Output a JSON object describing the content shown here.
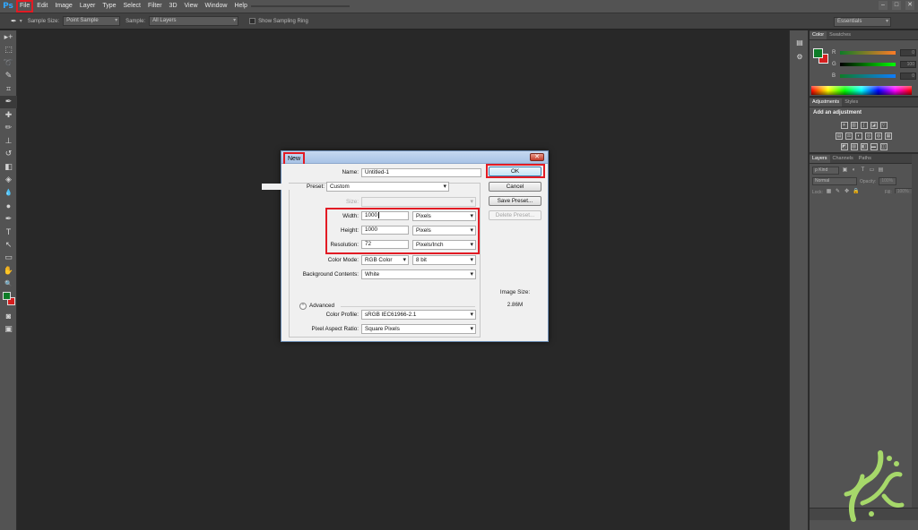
{
  "app": {
    "logo": "Ps"
  },
  "menu": [
    "File",
    "Edit",
    "Image",
    "Layer",
    "Type",
    "Select",
    "Filter",
    "3D",
    "View",
    "Window",
    "Help"
  ],
  "window_controls": [
    "–",
    "□",
    "✕"
  ],
  "options_bar": {
    "sample_size_label": "Sample Size:",
    "sample_size_value": "Point Sample",
    "sample_label": "Sample:",
    "sample_value": "All Layers",
    "show_ring_label": "Show Sampling Ring",
    "workspace": "Essentials"
  },
  "tools": [
    "move-icon",
    "marquee-icon",
    "lasso-icon",
    "quick-select-icon",
    "crop-icon",
    "eyedropper-icon",
    "spot-healing-icon",
    "brush-icon",
    "clone-stamp-icon",
    "history-brush-icon",
    "eraser-icon",
    "paint-bucket-icon",
    "blur-icon",
    "dodge-icon",
    "pen-icon",
    "type-icon",
    "path-select-icon",
    "rectangle-icon",
    "hand-icon",
    "zoom-icon"
  ],
  "tool_glyphs": [
    "▸+",
    "⬚",
    "➰",
    "✎",
    "⌗",
    "✒",
    "✚",
    "✏",
    "⊥",
    "↺",
    "◧",
    "◈",
    "💧",
    "●",
    "✒",
    "T",
    "↖",
    "▭",
    "✋",
    "🔍"
  ],
  "colors": {
    "foreground": "#0e7c27",
    "background": "#d41e1e",
    "highlight": "#e21b24"
  },
  "color_panel": {
    "tabs": [
      "Color",
      "Swatches"
    ],
    "channels": [
      {
        "name": "R",
        "value": "0"
      },
      {
        "name": "G",
        "value": "100"
      },
      {
        "name": "B",
        "value": "0"
      }
    ]
  },
  "adjustments_panel": {
    "tabs": [
      "Adjustments",
      "Styles"
    ],
    "title": "Add an adjustment"
  },
  "layers_panel": {
    "tabs": [
      "Layers",
      "Channels",
      "Paths"
    ],
    "kind_label": "ρ Kind",
    "blend_mode": "Normal",
    "opacity_label": "Opacity:",
    "opacity_value": "100%",
    "lock_label": "Lock:",
    "fill_label": "Fill:",
    "fill_value": "100%"
  },
  "dialog": {
    "title": "New",
    "close_glyph": "✕",
    "fields": {
      "name_label": "Name:",
      "name_value": "Untitled-1",
      "preset_label": "Preset:",
      "preset_value": "Custom",
      "size_label": "Size:",
      "size_value": "",
      "width_label": "Width:",
      "width_value": "1000",
      "width_unit": "Pixels",
      "height_label": "Height:",
      "height_value": "1000",
      "height_unit": "Pixels",
      "resolution_label": "Resolution:",
      "resolution_value": "72",
      "resolution_unit": "Pixels/Inch",
      "color_mode_label": "Color Mode:",
      "color_mode_value": "RGB Color",
      "bit_depth_value": "8 bit",
      "background_label": "Background Contents:",
      "background_value": "White",
      "advanced_label": "Advanced",
      "color_profile_label": "Color Profile:",
      "color_profile_value": "sRGB IEC61966-2.1",
      "aspect_label": "Pixel Aspect Ratio:",
      "aspect_value": "Square Pixels"
    },
    "buttons": {
      "ok": "OK",
      "cancel": "Cancel",
      "save_preset": "Save Preset...",
      "delete_preset": "Delete Preset..."
    },
    "image_size_label": "Image Size:",
    "image_size_value": "2.86M"
  }
}
